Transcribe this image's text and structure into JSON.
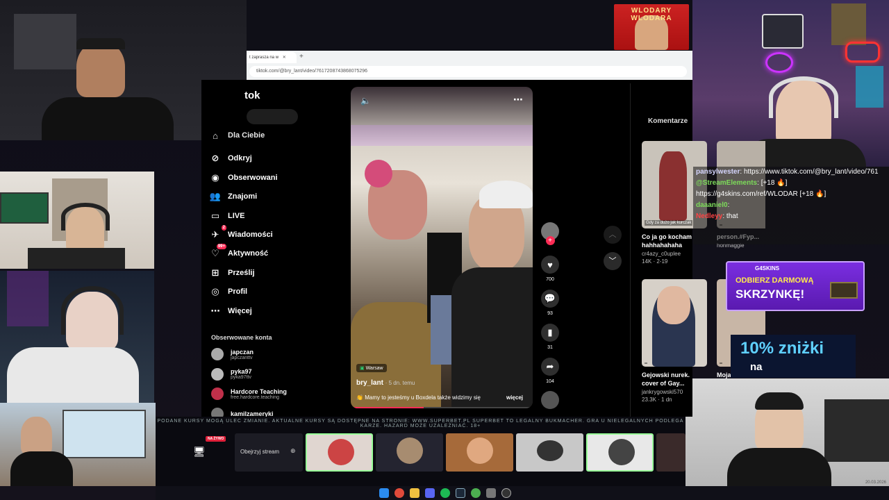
{
  "browser": {
    "tab_title": "t zaprasza na w",
    "url": "tiktok.com/@bry_lant/video/7617208743868075296"
  },
  "overlay": {
    "banner": "WLODARY WLODARA",
    "promo_brand": "G4SKINS",
    "promo_line1": "ODBIERZ DARMOWĄ",
    "promo_line2": "SKRZYNKĘ!",
    "discount": "10% zniżki",
    "discount_sub": "na",
    "ticker": "PODANE KURSY MOGĄ ULEC ZMIANIE. AKTUALNE KURSY SĄ DOSTĘPNE NA STRONIE: WWW.SUPERBET.PL SUPERBET TO LEGALNY BUKMACHER. GRA U NIELEGALNYCH PODLEGA KARZE. HAZARD MOŻE UZALEŻNIAĆ. 18+",
    "live_badge": "NA ŻYWO",
    "watch_stream": "Obejrzyj stream",
    "date": "20.03.2026"
  },
  "tiktok": {
    "logo": "tok",
    "nav": [
      {
        "label": "Dla Ciebie",
        "icon": "home"
      },
      {
        "label": "Odkryj",
        "icon": "compass"
      },
      {
        "label": "Obserwowani",
        "icon": "following"
      },
      {
        "label": "Znajomi",
        "icon": "friends"
      },
      {
        "label": "LIVE",
        "icon": "live"
      },
      {
        "label": "Wiadomości",
        "icon": "messages",
        "badge": "2"
      },
      {
        "label": "Aktywność",
        "icon": "activity",
        "badge": "99+"
      },
      {
        "label": "Prześlij",
        "icon": "upload"
      },
      {
        "label": "Profil",
        "icon": "profile"
      },
      {
        "label": "Więcej",
        "icon": "more"
      }
    ],
    "followed_title": "Obserwowane konta",
    "followed": [
      {
        "name": "japczan",
        "handle": "japczanttv"
      },
      {
        "name": "pyka97",
        "handle": "pyka97ttv"
      },
      {
        "name": "Hardcore Teaching",
        "handle": "free.hardcore.teaching"
      },
      {
        "name": "kamilzameryki",
        "handle": ""
      }
    ],
    "video": {
      "location": "Warsaw",
      "author": "bry_lant",
      "age": "5 dn. temu",
      "caption": "Mamy to jesteśmy u Boxdela także widzimy się",
      "more": "więcej",
      "likes": "700",
      "comments": "93",
      "saves": "31",
      "shares": "104"
    },
    "comments_tab": "Komentarze",
    "cards": [
      {
        "thumb_text": "Gdy za dużo jak kurczak",
        "caption": "Co ja go kocham hahhahahaha",
        "author": "cr4azy_c0uplee",
        "stats": "14K · 2-19"
      },
      {
        "thumb_text": "",
        "caption": "person.#Fyp...",
        "author": "honmaggie",
        "stats": ""
      },
      {
        "thumb_text": "",
        "caption": "Gejowski nurek. cover of Gay...",
        "author": "jankrygowski570",
        "stats": "23.3K · 1 dn"
      },
      {
        "thumb_text": "",
        "caption": "Moja",
        "author": "",
        "stats": ""
      }
    ]
  },
  "chat": [
    {
      "user": "pansylwester",
      "user_color": "#d6d6ff",
      "text": "https://www.tiktok.com/@bry_lant/video/761"
    },
    {
      "user": "@StreamElements",
      "user_color": "#7ddc5a",
      "text": "[+18 🔥]"
    },
    {
      "user": "",
      "user_color": "#fff",
      "text": "https://g4skins.com/ref/WLODAR [+18 🔥]"
    },
    {
      "user": "daaaniel0",
      "user_color": "#7ddc5a",
      "text": ""
    },
    {
      "user": "Nedleyy",
      "user_color": "#ff4444",
      "text": "that"
    }
  ]
}
